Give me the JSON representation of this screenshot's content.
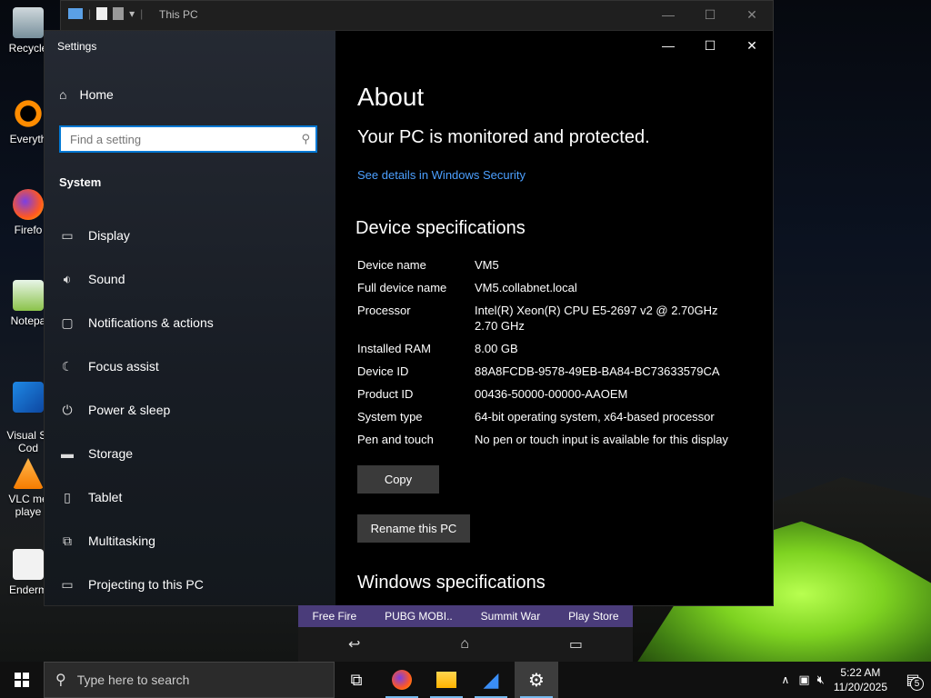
{
  "desktop": {
    "icons": [
      {
        "label": "Recycle",
        "color": "#9aa6b2"
      },
      {
        "label": "Everyth",
        "color": "#ff8c00"
      },
      {
        "label": "Firefo",
        "color": "#ff5722"
      },
      {
        "label": "Notepa",
        "color": "#8bc34a"
      },
      {
        "label": "Visual St\nCod",
        "color": "#1e88e5"
      },
      {
        "label": "VLC me\nplaye",
        "color": "#ff9800"
      },
      {
        "label": "Enderm",
        "color": "#eeeeee"
      }
    ]
  },
  "back_window": {
    "title": "This PC"
  },
  "settings": {
    "app_title": "Settings",
    "home_label": "Home",
    "search_placeholder": "Find a setting",
    "section_label": "System",
    "nav_items": [
      {
        "label": "Display",
        "icon": "monitor-icon"
      },
      {
        "label": "Sound",
        "icon": "speaker-icon"
      },
      {
        "label": "Notifications & actions",
        "icon": "message-icon"
      },
      {
        "label": "Focus assist",
        "icon": "moon-icon"
      },
      {
        "label": "Power & sleep",
        "icon": "power-icon"
      },
      {
        "label": "Storage",
        "icon": "storage-icon"
      },
      {
        "label": "Tablet",
        "icon": "tablet-icon"
      },
      {
        "label": "Multitasking",
        "icon": "multitasking-icon"
      },
      {
        "label": "Projecting to this PC",
        "icon": "projecting-icon"
      }
    ],
    "content": {
      "title": "About",
      "protection": "Your PC is monitored and protected.",
      "security_link": "See details in Windows Security",
      "device_spec_heading": "Device specifications",
      "specs": [
        {
          "key": "Device name",
          "value": "VM5"
        },
        {
          "key": "Full device name",
          "value": "VM5.collabnet.local"
        },
        {
          "key": "Processor",
          "value": "Intel(R) Xeon(R) CPU E5-2697 v2 @ 2.70GHz\n2.70 GHz"
        },
        {
          "key": "Installed RAM",
          "value": "8.00 GB"
        },
        {
          "key": "Device ID",
          "value": "88A8FCDB-9578-49EB-BA84-BC73633579CA"
        },
        {
          "key": "Product ID",
          "value": "00436-50000-00000-AAOEM"
        },
        {
          "key": "System type",
          "value": "64-bit operating system, x64-based processor"
        },
        {
          "key": "Pen and touch",
          "value": "No pen or touch input is available for this display"
        }
      ],
      "copy_label": "Copy",
      "rename_label": "Rename this PC",
      "windows_spec_heading": "Windows specifications"
    }
  },
  "phone_mirror": {
    "apps": [
      "Free Fire",
      "PUBG MOBI..",
      "Summit War",
      "Play Store"
    ]
  },
  "taskbar": {
    "search_placeholder": "Type here to search",
    "time": "5:22 AM",
    "date": "11/20/2025",
    "notification_count": "5"
  },
  "colors": {
    "accent": "#0078d4",
    "link": "#4ca0ff",
    "taskbar": "#101010"
  }
}
